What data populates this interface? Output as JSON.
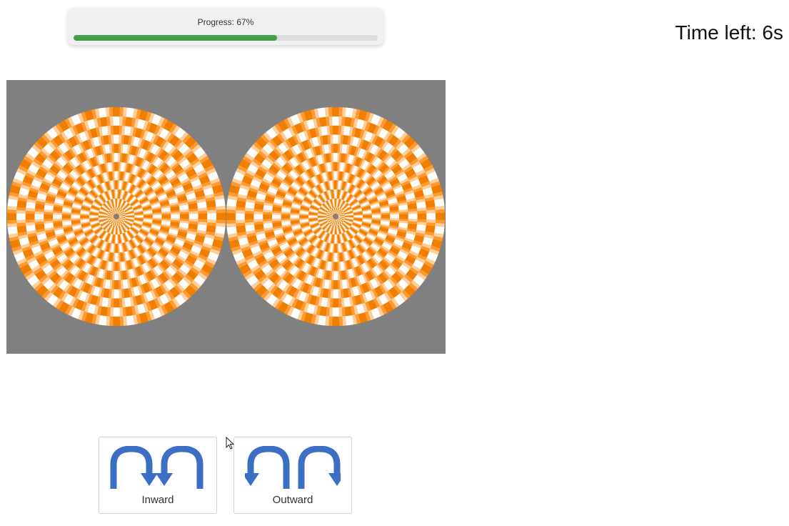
{
  "progress": {
    "label": "Progress: 67%",
    "value": 0.67,
    "color": "#43a047"
  },
  "timer": {
    "text": "Time left: 6s"
  },
  "stimulus": {
    "background_color": "#808080",
    "colors": [
      "#ffffff",
      "#ffcf9a",
      "#ff9a33",
      "#f07f00"
    ]
  },
  "choices": [
    {
      "label": "Inward",
      "icon": "arrows-inward-icon"
    },
    {
      "label": "Outward",
      "icon": "arrows-outward-icon"
    }
  ],
  "arrow_color": "#3a6fc4"
}
